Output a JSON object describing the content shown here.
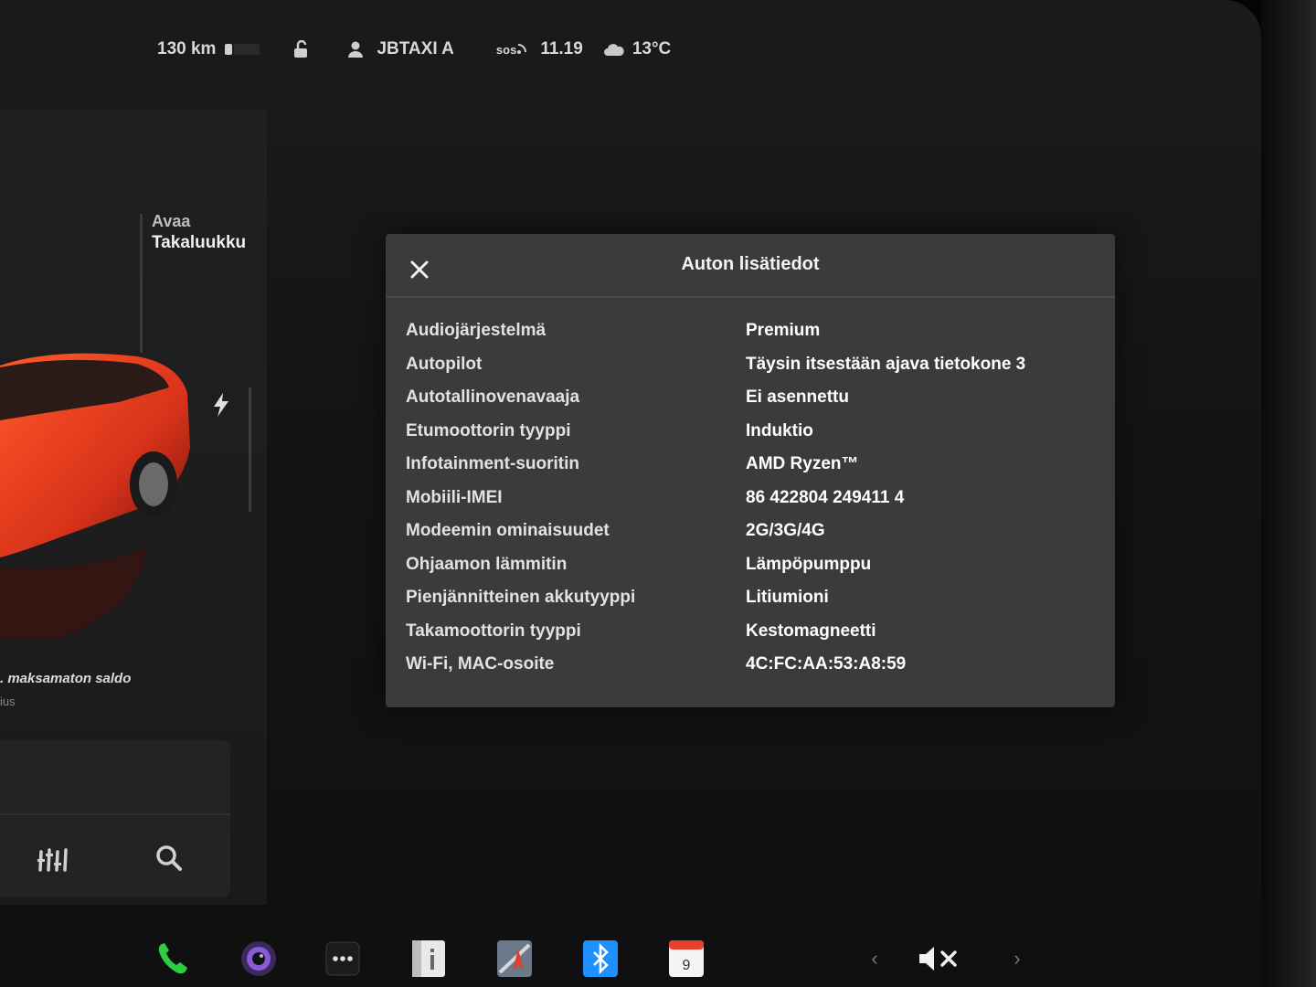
{
  "status_bar": {
    "range": "130 km",
    "driver": "JBTAXI A",
    "sos": "SOS",
    "time": "11.19",
    "temperature": "13°C"
  },
  "left_panel": {
    "trunk_line1": "Avaa",
    "trunk_line2": "Takaluukku",
    "unpaid_balance": ". maksamaton saldo",
    "unpaid_sub": "ius"
  },
  "modal": {
    "title": "Auton lisätiedot",
    "rows": [
      {
        "label": "Audiojärjestelmä",
        "value": "Premium"
      },
      {
        "label": "Autopilot",
        "value": "Täysin itsestään ajava tietokone 3"
      },
      {
        "label": "Autotallinovenavaaja",
        "value": "Ei asennettu"
      },
      {
        "label": "Etumoottorin tyyppi",
        "value": "Induktio"
      },
      {
        "label": "Infotainment-suoritin",
        "value": "AMD Ryzen™"
      },
      {
        "label": "Mobiili-IMEI",
        "value": "86 422804 249411 4"
      },
      {
        "label": "Modeemin ominaisuudet",
        "value": "2G/3G/4G"
      },
      {
        "label": "Ohjaamon lämmitin",
        "value": "Lämpöpumppu"
      },
      {
        "label": "Pienjännitteinen akkutyyppi",
        "value": "Litiumioni"
      },
      {
        "label": "Takamoottorin tyyppi",
        "value": "Kestomagneetti"
      },
      {
        "label": "Wi-Fi, MAC-osoite",
        "value": "4C:FC:AA:53:A8:59"
      }
    ]
  },
  "dock": {
    "calendar_day": "9",
    "chevron_left": "‹",
    "chevron_right": "›"
  },
  "colors": {
    "modal_bg": "#3b3b3c",
    "car_red": "#d8321a",
    "phone_green": "#2ecc40",
    "bluetooth_blue": "#1e90ff"
  }
}
